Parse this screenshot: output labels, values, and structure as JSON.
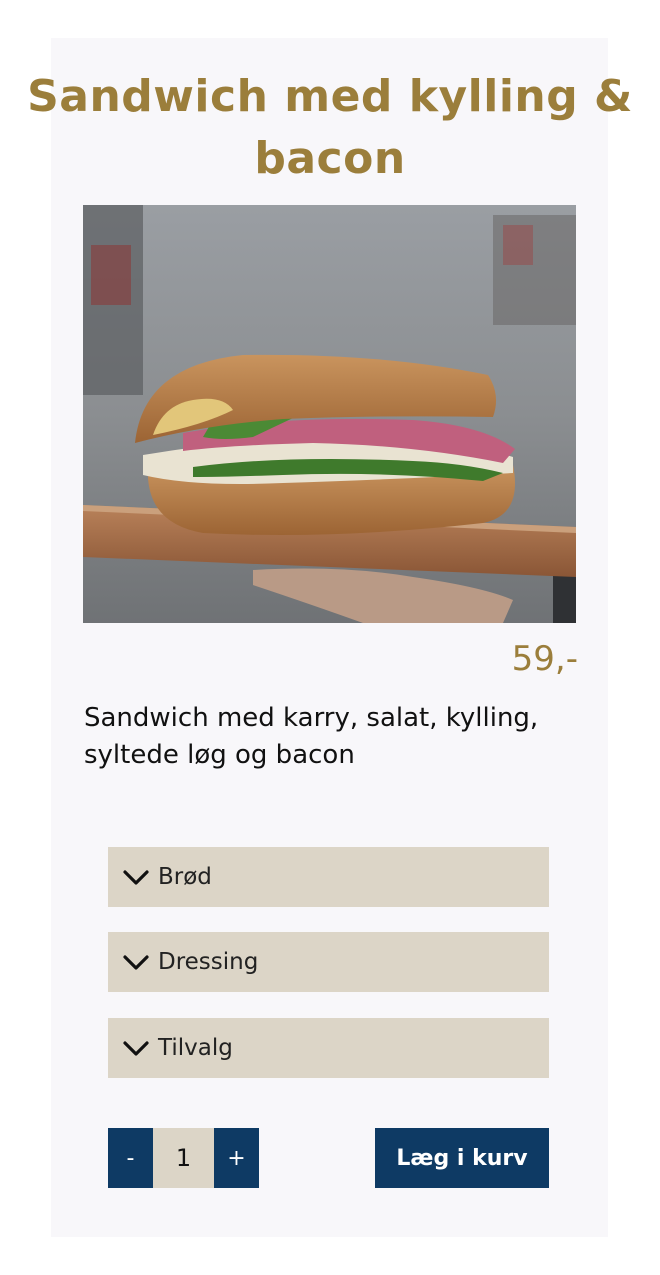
{
  "product": {
    "title": "Sandwich med kylling & bacon",
    "price": "59,-",
    "description": "Sandwich med karry, salat, kylling, syltede løg og bacon",
    "image_icon": "sandwich-photo"
  },
  "options": [
    {
      "label": "Brød",
      "icon": "chevron-down-icon"
    },
    {
      "label": "Dressing",
      "icon": "chevron-down-icon"
    },
    {
      "label": "Tilvalg",
      "icon": "chevron-down-icon"
    }
  ],
  "cart": {
    "minus_label": "-",
    "quantity": "1",
    "plus_label": "+",
    "add_label": "Læg i kurv"
  },
  "colors": {
    "accent_gold": "#9b7e3b",
    "button_navy": "#0e3a64",
    "panel_beige": "#dcd5c7",
    "card_bg": "#f8f7fa"
  }
}
